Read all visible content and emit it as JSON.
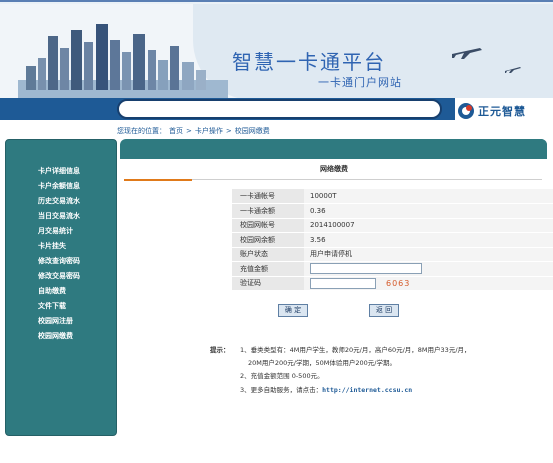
{
  "header": {
    "title": "智慧一卡通平台",
    "subtitle": "一卡通门户网站",
    "brand": "正元智慧"
  },
  "breadcrumb": {
    "prefix": "您现在的位置：",
    "items": [
      "首页",
      "卡户操作",
      "校园网缴费"
    ],
    "separator": ">"
  },
  "sidebar": {
    "items": [
      "卡户详细信息",
      "卡户余额信息",
      "历史交易流水",
      "当日交易流水",
      "月交易统计",
      "卡片挂失",
      "修改查询密码",
      "修改交易密码",
      "自助缴费",
      "文件下载",
      "校园网注册",
      "校园网缴费"
    ]
  },
  "panel": {
    "title": "网络缴费",
    "rows": [
      {
        "label": "一卡通帐号",
        "value": "10000T"
      },
      {
        "label": "一卡通余额",
        "value": "0.36"
      },
      {
        "label": "校园网帐号",
        "value": "2014100007"
      },
      {
        "label": "校园网余额",
        "value": "3.56"
      },
      {
        "label": "账户状态",
        "value": "用户申请停机"
      },
      {
        "label": "充值金额",
        "value": ""
      },
      {
        "label": "验证码",
        "value": "6063"
      }
    ],
    "confirm_label": "确 定",
    "back_label": "返 回"
  },
  "tips": {
    "head": "提示：",
    "line1": "1、垂类类型有：4M用户学生，教师20元/月，高户60元/月，8M用户33元/月，",
    "line2": "20M用户200元/学期，50M体验用户200元/学期。",
    "line3": "2、充值金额范围 0-500元。",
    "line4_prefix": "3、更多自助服务，请点击：",
    "line4_link": "http://internet.ccsu.cn"
  },
  "colors": {
    "sidebar_bg": "#2f7a80",
    "nav_blue": "#1e5a96",
    "accent_orange": "#e07a1a"
  }
}
